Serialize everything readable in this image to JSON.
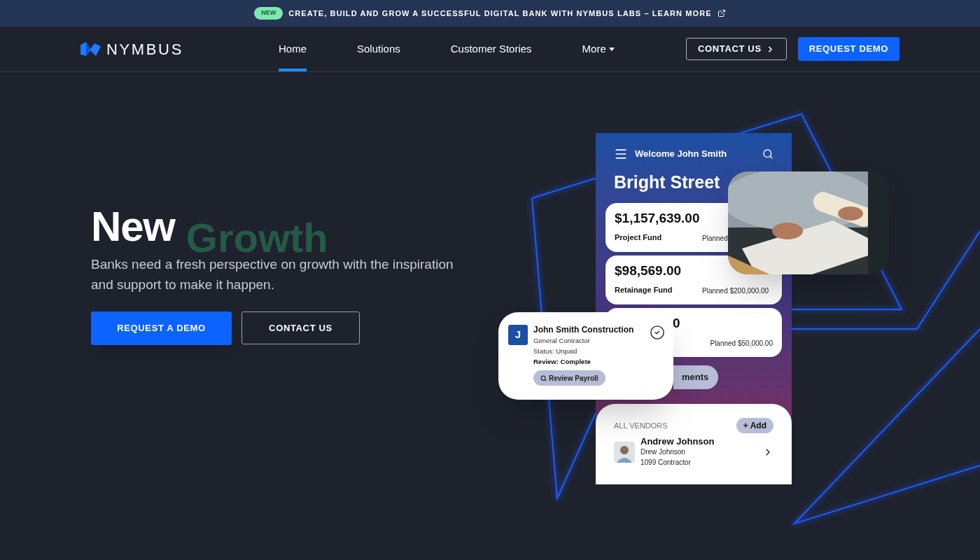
{
  "banner": {
    "badge": "NEW",
    "text": "CREATE, BUILD AND GROW A SUCCESSFUL DIGITAL BANK WITH NYMBUS LABS – LEARN MORE"
  },
  "nav": {
    "logo": "NYMBUS",
    "items": [
      {
        "label": "Home",
        "selected": true,
        "kind": "link"
      },
      {
        "label": "Solutions",
        "selected": false,
        "kind": "link"
      },
      {
        "label": "Customer Stories",
        "selected": false,
        "kind": "link"
      },
      {
        "label": "More",
        "selected": false,
        "kind": "dropdown"
      }
    ],
    "contact_button": "CONTACT US",
    "demo_button": "REQUEST DEMO"
  },
  "hero": {
    "title": "New",
    "title_accent": "Growth",
    "body": "Banks need a fresh perspective on growth with the inspiration and support to make it happen.",
    "primary_button": "REQUEST A DEMO",
    "secondary_button": "CONTACT US"
  },
  "mockup": {
    "welcome": "Welcome John Smith",
    "heading": "Bright Street",
    "funds": [
      {
        "amount": "$1,157,639.00",
        "name": "Project Fund",
        "planned": "Planned"
      },
      {
        "amount": "$98,569.00",
        "name": "Retainage Fund",
        "planned": "Planned $200,000.00"
      },
      {
        "amount": "0",
        "planned": "Planned $50,000.00"
      }
    ],
    "pill": "ments",
    "contractor": {
      "initial": "J",
      "name": "John Smith Construction",
      "role": "General Contractor",
      "status": "Status: Unpaid",
      "review": "Review: Complete",
      "button": "Review Payroll"
    },
    "vendors": {
      "heading": "ALL VENDORS",
      "add": "+ Add",
      "vendor": {
        "name": "Andrew Johnson",
        "nickname": "Drew Johnson",
        "type": "1099 Contractor"
      }
    }
  }
}
